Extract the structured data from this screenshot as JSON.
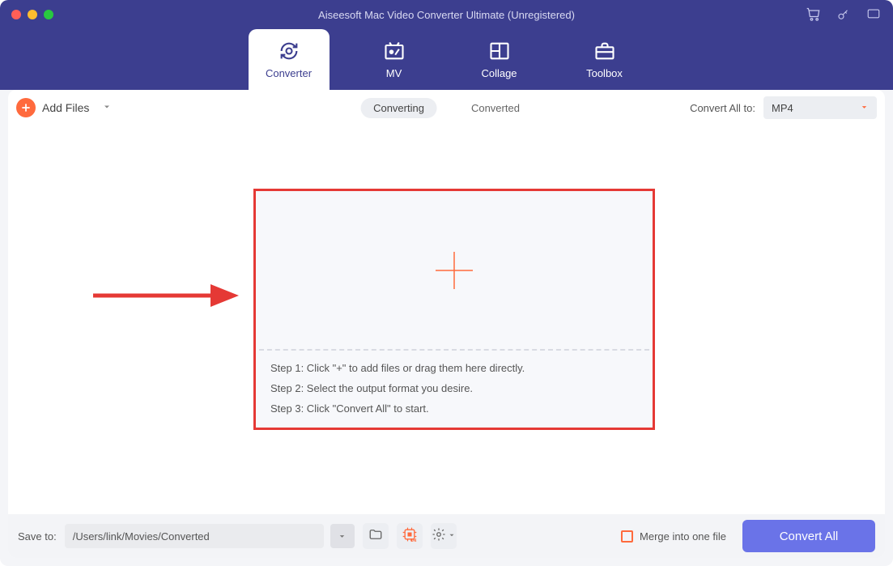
{
  "window": {
    "title": "Aiseesoft Mac Video Converter Ultimate (Unregistered)"
  },
  "nav": {
    "tabs": [
      {
        "label": "Converter",
        "icon": "convert-icon"
      },
      {
        "label": "MV",
        "icon": "mv-icon"
      },
      {
        "label": "Collage",
        "icon": "collage-icon"
      },
      {
        "label": "Toolbox",
        "icon": "toolbox-icon"
      }
    ]
  },
  "toolbar": {
    "add_files_label": "Add Files",
    "center_tabs": [
      {
        "label": "Converting"
      },
      {
        "label": "Converted"
      }
    ],
    "convert_all_to_label": "Convert All to:",
    "selected_format": "MP4"
  },
  "dropzone": {
    "steps": [
      "Step 1: Click \"+\" to add files or drag them here directly.",
      "Step 2: Select the output format you desire.",
      "Step 3: Click \"Convert All\" to start."
    ]
  },
  "bottombar": {
    "save_to_label": "Save to:",
    "save_to_path": "/Users/link/Movies/Converted",
    "merge_label": "Merge into one file",
    "convert_all_label": "Convert All"
  },
  "colors": {
    "accent_purple": "#3c3e8f",
    "accent_orange": "#ff6a3d",
    "button_blue": "#6a73e8",
    "highlight_red": "#e53935"
  }
}
